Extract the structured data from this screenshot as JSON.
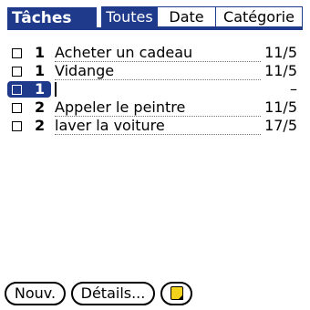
{
  "header": {
    "title": "Tâches",
    "tabs": [
      {
        "label": "Toutes",
        "active": true
      },
      {
        "label": "Date",
        "active": false
      },
      {
        "label": "Catégorie",
        "active": false
      }
    ]
  },
  "tasks": [
    {
      "done": false,
      "priority": "1",
      "description": "Acheter un cadeau",
      "due": "11/5",
      "selected": false
    },
    {
      "done": false,
      "priority": "1",
      "description": "Vidange",
      "due": "11/5",
      "selected": false
    },
    {
      "done": false,
      "priority": "1",
      "description": "",
      "due": "–",
      "selected": true
    },
    {
      "done": false,
      "priority": "2",
      "description": "Appeler le peintre",
      "due": "11/5",
      "selected": false
    },
    {
      "done": false,
      "priority": "2",
      "description": "laver la voiture",
      "due": "17/5",
      "selected": false
    }
  ],
  "buttons": {
    "new": "Nouv.",
    "details": "Détails...",
    "note_icon": "note-icon"
  },
  "colors": {
    "accent": "#1f3a8a",
    "note": "#f3d21c"
  }
}
